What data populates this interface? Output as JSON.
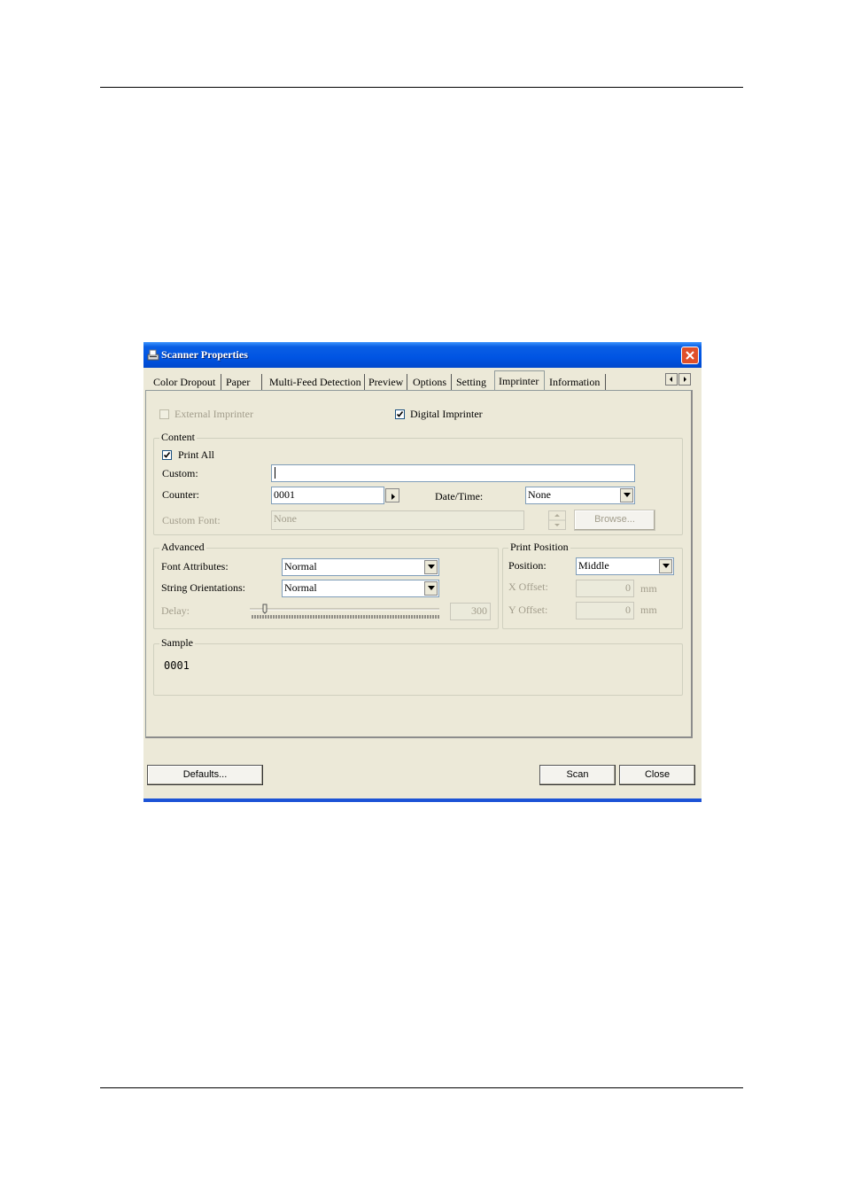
{
  "window": {
    "title": "Scanner Properties",
    "tabs": [
      "Color Dropout",
      "Paper",
      "Multi-Feed Detection",
      "Preview",
      "Options",
      "Setting",
      "Imprinter",
      "Information"
    ],
    "selected_tab": "Imprinter"
  },
  "imprinter": {
    "external_label": "External Imprinter",
    "digital_label": "Digital Imprinter",
    "digital_checked": true
  },
  "content": {
    "caption": "Content",
    "print_all_label": "Print All",
    "print_all_checked": true,
    "custom_label": "Custom:",
    "custom_value": "",
    "counter_label": "Counter:",
    "counter_value": "0001",
    "datetime_label": "Date/Time:",
    "datetime_value": "None",
    "custom_font_label": "Custom Font:",
    "custom_font_value": "None",
    "browse_label": "Browse..."
  },
  "advanced": {
    "caption": "Advanced",
    "font_attr_label": "Font Attributes:",
    "font_attr_value": "Normal",
    "string_orient_label": "String Orientations:",
    "string_orient_value": "Normal",
    "delay_label": "Delay:",
    "delay_value": "300"
  },
  "print_position": {
    "caption": "Print Position",
    "position_label": "Position:",
    "position_value": "Middle",
    "x_label": "X Offset:",
    "x_value": "0",
    "y_label": "Y Offset:",
    "y_value": "0",
    "unit": "mm"
  },
  "sample": {
    "caption": "Sample",
    "value": "0001"
  },
  "buttons": {
    "defaults": "Defaults...",
    "scan": "Scan",
    "close": "Close"
  },
  "colors": {
    "titlebar": "#0054e3",
    "dialog_bg": "#ece9d8",
    "close_button": "#e0502a"
  }
}
